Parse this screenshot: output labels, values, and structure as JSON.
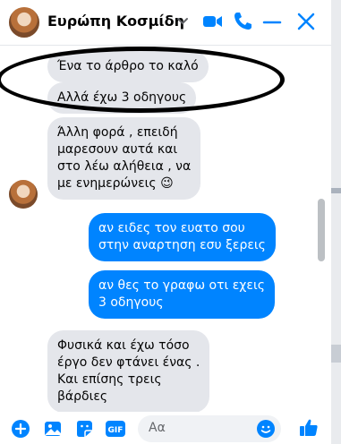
{
  "header": {
    "contact_name": "Ευρώπη Κοσμίδη"
  },
  "messages": [
    {
      "text": "Ένα το άρθρο το καλό",
      "from": "contact"
    },
    {
      "text": "Αλλά έχω 3 οδηγους",
      "from": "contact"
    },
    {
      "text": "Άλλη φορά , επειδή\nμαρεσουν αυτά και\nστο λέω αλήθεια , να\nμε ενημερώνεις 😉",
      "from": "contact"
    },
    {
      "text": "αν ειδες τον ευατο σου\nστην αναρτηση εσυ ξερεις",
      "from": "me"
    },
    {
      "text": "αν θες το γραφω οτι εχεις\n3 οδηγους",
      "from": "me"
    },
    {
      "text": "Φυσικά και έχω τόσο\nέργο δεν φτάνει ένας .\nΚαι επίσης τρεις\nβάρδιες",
      "from": "contact"
    }
  ],
  "composer": {
    "placeholder": "Αα"
  },
  "colors": {
    "accent": "#0084ff",
    "incoming_bubble": "#e4e6eb",
    "annotation": "#000000"
  },
  "icons": [
    "chevron-down-icon",
    "video-call-icon",
    "phone-icon",
    "minimize-icon",
    "close-icon",
    "plus-icon",
    "photo-icon",
    "sticker-icon",
    "gif-icon",
    "emoji-icon",
    "like-icon"
  ]
}
